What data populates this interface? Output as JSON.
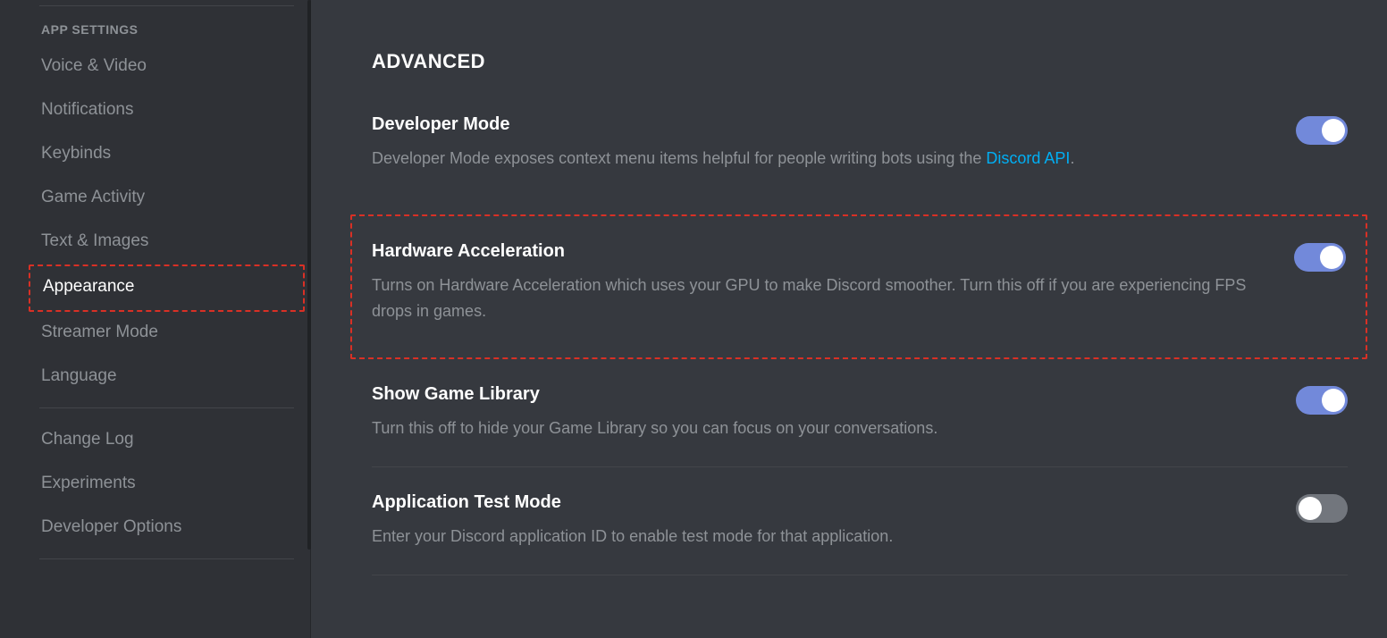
{
  "sidebar": {
    "header": "APP SETTINGS",
    "items": [
      {
        "label": "Voice & Video",
        "active": false
      },
      {
        "label": "Notifications",
        "active": false
      },
      {
        "label": "Keybinds",
        "active": false
      },
      {
        "label": "Game Activity",
        "active": false
      },
      {
        "label": "Text & Images",
        "active": false
      },
      {
        "label": "Appearance",
        "active": true,
        "highlight": true
      },
      {
        "label": "Streamer Mode",
        "active": false
      },
      {
        "label": "Language",
        "active": false
      }
    ],
    "footer_items": [
      {
        "label": "Change Log"
      },
      {
        "label": "Experiments"
      },
      {
        "label": "Developer Options"
      }
    ]
  },
  "main": {
    "header": "ADVANCED",
    "settings": [
      {
        "title": "Developer Mode",
        "desc_pre": "Developer Mode exposes context menu items helpful for people writing bots using the ",
        "link_text": "Discord API",
        "desc_post": ".",
        "toggle": "on"
      },
      {
        "title": "Hardware Acceleration",
        "desc": "Turns on Hardware Acceleration which uses your GPU to make Discord smoother. Turn this off if you are experiencing FPS drops in games.",
        "toggle": "on",
        "highlight": true
      },
      {
        "title": "Show Game Library",
        "desc": "Turn this off to hide your Game Library so you can focus on your conversations.",
        "toggle": "on"
      },
      {
        "title": "Application Test Mode",
        "desc": "Enter your Discord application ID to enable test mode for that application.",
        "toggle": "off"
      }
    ]
  }
}
